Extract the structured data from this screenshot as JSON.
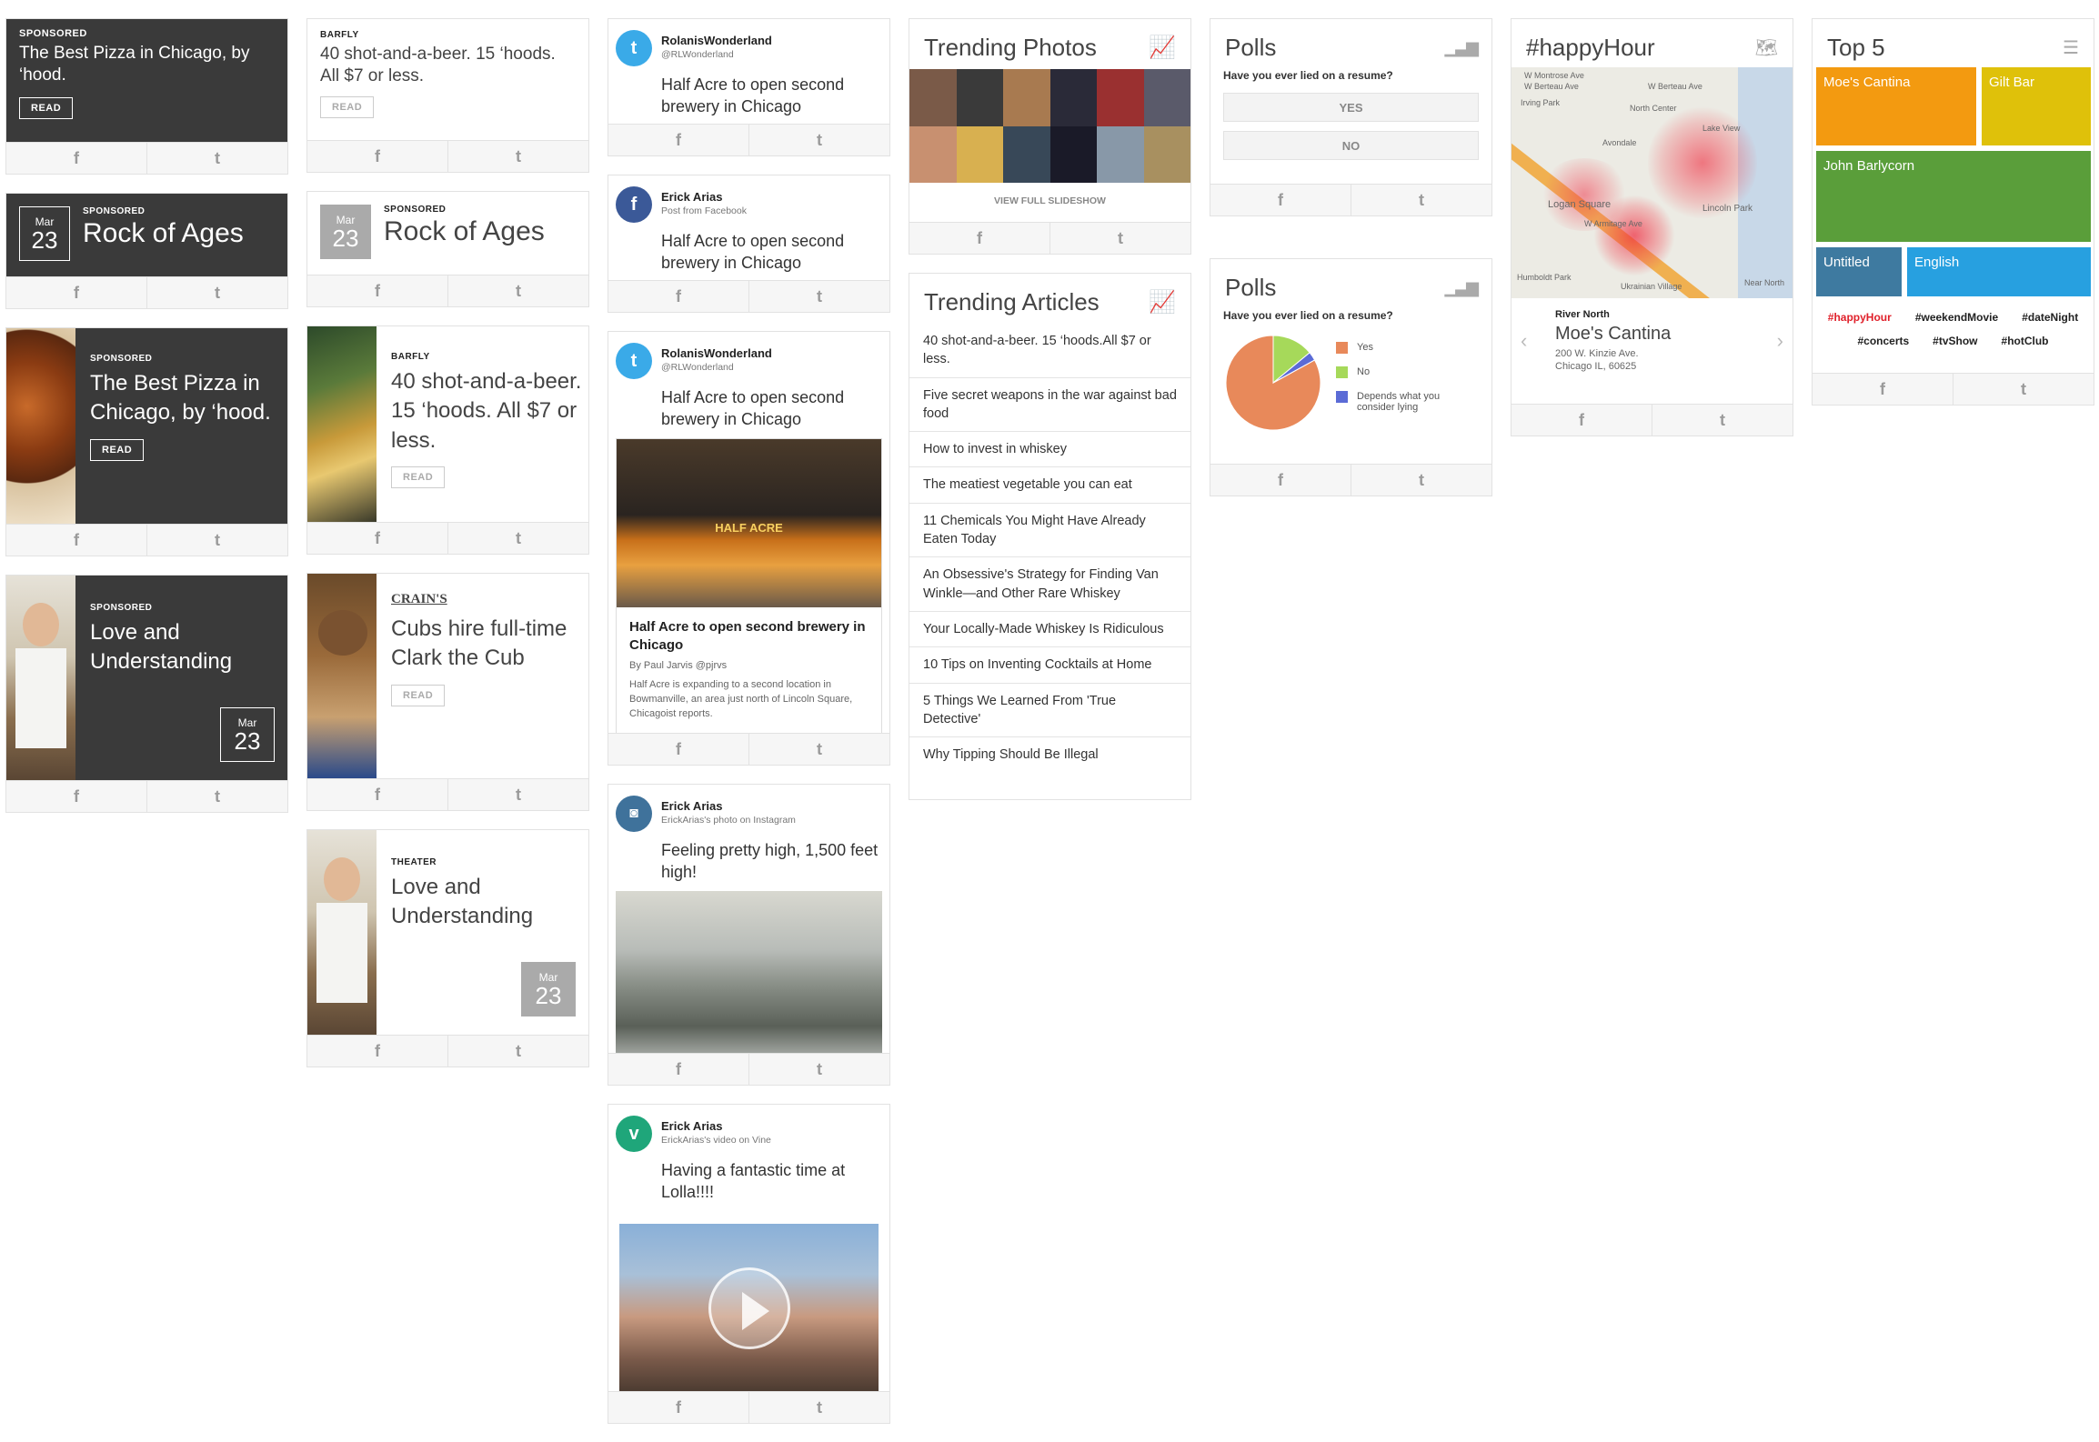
{
  "common": {
    "read": "READ",
    "fb_icon": "f",
    "tw_icon": "t"
  },
  "col1": {
    "c1": {
      "kicker": "SPONSORED",
      "title": "The Best Pizza in Chicago, by ‘hood."
    },
    "c2": {
      "month": "Mar",
      "day": "23",
      "kicker": "SPONSORED",
      "title": "Rock of Ages"
    },
    "c3": {
      "kicker": "SPONSORED",
      "title": "The Best Pizza in Chicago, by ‘hood."
    },
    "c4": {
      "kicker": "SPONSORED",
      "title": "Love and Understanding",
      "month": "Mar",
      "day": "23"
    }
  },
  "col2": {
    "c1": {
      "kicker": "BARFLY",
      "title": "40 shot-and-a-beer. 15 ‘hoods. All $7 or less."
    },
    "c2": {
      "month": "Mar",
      "day": "23",
      "kicker": "SPONSORED",
      "title": "Rock of Ages"
    },
    "c3": {
      "kicker": "BARFLY",
      "title": "40 shot-and-a-beer. 15 ‘hoods. All $7 or less."
    },
    "c4": {
      "logo": "CRAIN'S",
      "title": "Cubs hire full-time Clark the Cub"
    },
    "c5": {
      "kicker": "THEATER",
      "title": "Love and Understanding",
      "month": "Mar",
      "day": "23"
    }
  },
  "col3": {
    "s1": {
      "name": "RolanisWonderland",
      "sub": "@RLWonderland",
      "body": "Half Acre to open second brewery in Chicago"
    },
    "s2": {
      "name": "Erick Arias",
      "sub": "Post from Facebook",
      "body": "Half Acre to open second brewery in Chicago"
    },
    "s3": {
      "name": "RolanisWonderland",
      "sub": "@RLWonderland",
      "body": "Half Acre to open second brewery in Chicago",
      "art_title": "Half Acre to open second brewery in Chicago",
      "art_by": "By Paul Jarvis @pjrvs",
      "art_text": "Half Acre is expanding to a second location in Bowmanville, an area just north of Lincoln Square, Chicagoist reports.",
      "sign": "HALF ACRE"
    },
    "s4": {
      "name": "Erick Arias",
      "sub": "ErickArias's photo on Instagram",
      "body": "Feeling pretty high, 1,500 feet high!"
    },
    "s5": {
      "name": "Erick Arias",
      "sub": "ErickArias's video on Vine",
      "body": "Having a fantastic time at Lolla!!!!"
    }
  },
  "col4": {
    "photos": {
      "title": "Trending Photos",
      "link": "VIEW FULL SLIDESHOW"
    },
    "articles": {
      "title": "Trending Articles",
      "items": [
        "40 shot-and-a-beer. 15 ‘hoods.All $7 or less.",
        "Five secret weapons in the war against bad food",
        "How to invest in whiskey",
        "The meatiest vegetable you can eat",
        "11 Chemicals You Might Have Already Eaten Today",
        "An Obsessive's Strategy for Finding Van Winkle—and Other Rare Whiskey",
        "Your Locally-Made Whiskey Is Ridiculous",
        "10 Tips on Inventing Cocktails at Home",
        "5 Things We Learned From 'True Detective'",
        "Why Tipping Should Be Illegal"
      ]
    }
  },
  "col5": {
    "poll1": {
      "title": "Polls",
      "question": "Have you ever lied on a resume?",
      "yes": "YES",
      "no": "NO"
    },
    "poll2": {
      "title": "Polls",
      "question": "Have you ever lied on a resume?",
      "legend": [
        "Yes",
        "No",
        "Depends what you consider lying"
      ]
    }
  },
  "chart_data": {
    "type": "pie",
    "categories": [
      "Yes",
      "No",
      "Depends what you consider lying"
    ],
    "values": [
      83,
      14,
      3
    ],
    "colors": [
      "#e8895a",
      "#a6d95a",
      "#5b6bd6"
    ]
  },
  "col6": {
    "title": "#happyHour",
    "map_labels": [
      "W Montrose Ave",
      "W Berteau Ave",
      "W Berteau Ave",
      "Irving Park",
      "North Center",
      "Lake View",
      "Avondale",
      "Logan Square",
      "W Armitage Ave",
      "Lincoln Park",
      "Humboldt Park",
      "Ukrainian Village",
      "Near North"
    ],
    "hood": "River North",
    "venue": "Moe's Cantina",
    "addr1": "200 W. Kinzie Ave.",
    "addr2": "Chicago IL, 60625"
  },
  "col7": {
    "title": "Top 5",
    "tiles": [
      "Moe's Cantina",
      "Gilt Bar",
      "John Barlycorn",
      "Untitled",
      "English"
    ],
    "tags": [
      "#happyHour",
      "#weekendMovie",
      "#dateNight",
      "#concerts",
      "#tvShow",
      "#hotClub"
    ]
  }
}
